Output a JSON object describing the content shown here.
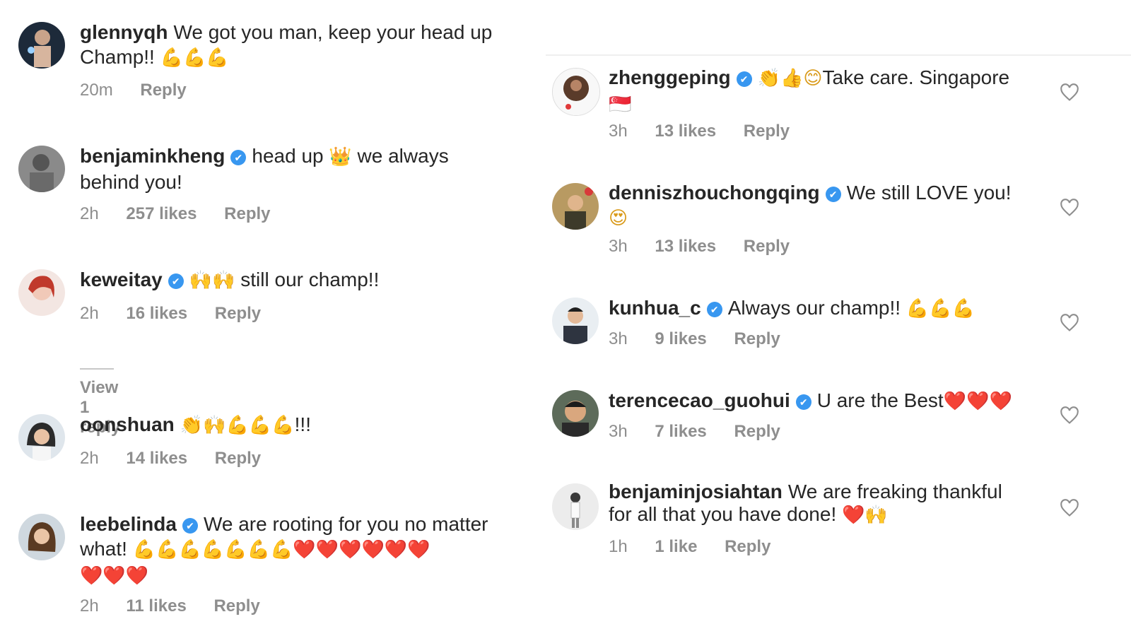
{
  "left": [
    {
      "user": "glennyqh",
      "verified": false,
      "text": "We got you man, keep your head up",
      "text2": "Champ!!",
      "emojis2": "💪💪💪",
      "time": "20m",
      "likes": "",
      "reply": "Reply"
    },
    {
      "user": "benjaminkheng",
      "verified": true,
      "text": "head up",
      "emoji_mid": "👑",
      "text_after": "we always",
      "text2": "behind you!",
      "time": "2h",
      "likes": "257 likes",
      "reply": "Reply"
    },
    {
      "user": "keweitay",
      "verified": true,
      "emojis": "🙌🙌",
      "text": "still our champ!!",
      "time": "2h",
      "likes": "16 likes",
      "reply": "Reply",
      "view_replies": "View 1 reply"
    },
    {
      "user": "oonshuan",
      "verified": false,
      "emojis": "👏🙌💪💪💪",
      "text": "!!!",
      "time": "2h",
      "likes": "14 likes",
      "reply": "Reply"
    },
    {
      "user": "leebelinda",
      "verified": true,
      "text": "We are rooting for you no matter",
      "text2": "what!",
      "emojis2_tan": "💪💪💪💪💪💪💪",
      "hearts2": "❤️❤️❤️❤️❤️❤️",
      "hearts3": "❤️❤️❤️",
      "time": "2h",
      "likes": "11 likes",
      "reply": "Reply"
    }
  ],
  "right": [
    {
      "user": "zhenggeping",
      "verified": true,
      "emojis": "👏👍😊",
      "text": "Take care. Singapore",
      "flag": "🇸🇬",
      "time": "3h",
      "likes": "13 likes",
      "reply": "Reply"
    },
    {
      "user": "denniszhouchongqing",
      "verified": true,
      "text": "We still LOVE you!",
      "emoji2": "😍",
      "time": "3h",
      "likes": "13 likes",
      "reply": "Reply"
    },
    {
      "user": "kunhua_c",
      "verified": true,
      "text": "Always our champ!!",
      "emojis_light": "💪💪💪",
      "time": "3h",
      "likes": "9 likes",
      "reply": "Reply"
    },
    {
      "user": "terencecao_guohui",
      "verified": true,
      "text": "U are the Best",
      "hearts": "❤️❤️❤️",
      "time": "3h",
      "likes": "7 likes",
      "reply": "Reply"
    },
    {
      "user": "benjaminjosiahtan",
      "verified": false,
      "text": "We are freaking thankful",
      "text2": "for all that you have done!",
      "emojis2": "❤️🙌",
      "time": "1h",
      "likes": "1 like",
      "reply": "Reply"
    }
  ],
  "icons": {
    "verified_check": "✔",
    "heart_outline": "heart-icon"
  },
  "colors": {
    "text": "#262626",
    "meta": "#8e8e8e",
    "verified": "#3897f0",
    "heart_emoji": "#e02424"
  }
}
